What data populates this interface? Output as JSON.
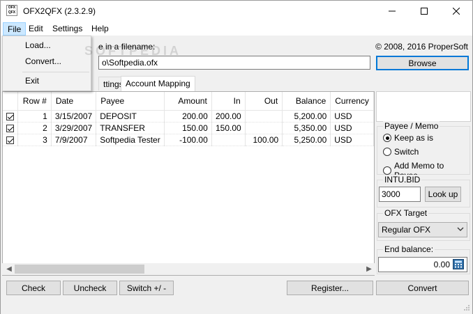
{
  "window": {
    "title": "OFX2QFX (2.3.2.9)",
    "icon_text": "OFX QFX"
  },
  "menu": [
    "File",
    "Edit",
    "Settings",
    "Help"
  ],
  "file_menu": [
    "Load...",
    "Convert...",
    "Exit"
  ],
  "top": {
    "file_label_visible": "e in a filename:",
    "file_value_visible": "o\\Softpedia.ofx",
    "copyright": "© 2008, 2016 ProperSoft",
    "browse": "Browse"
  },
  "tabs": [
    "ttings",
    "Account Mapping"
  ],
  "grid": {
    "columns": [
      "Row #",
      "Date",
      "Payee",
      "Amount",
      "In",
      "Out",
      "Balance",
      "Currency"
    ],
    "rows": [
      {
        "checked": true,
        "row": "1",
        "date": "3/15/2007",
        "payee": "DEPOSIT",
        "amount": "200.00",
        "in": "200.00",
        "out": "",
        "balance": "5,200.00",
        "currency": "USD"
      },
      {
        "checked": true,
        "row": "2",
        "date": "3/29/2007",
        "payee": "TRANSFER",
        "amount": "150.00",
        "in": "150.00",
        "out": "",
        "balance": "5,350.00",
        "currency": "USD"
      },
      {
        "checked": true,
        "row": "3",
        "date": "7/9/2007",
        "payee": "Softpedia Tester",
        "amount": "-100.00",
        "in": "",
        "out": "100.00",
        "balance": "5,250.00",
        "currency": "USD"
      }
    ]
  },
  "side": {
    "payee_title": "Payee / Memo",
    "radios": [
      "Keep as is",
      "Switch",
      "Add Memo to Payee"
    ],
    "selected_radio": "Keep as is",
    "intu_title": "INTU.BID",
    "intu_value": "3000",
    "lookup": "Look up",
    "ofx_target_title": "OFX Target",
    "ofx_target_value": "Regular OFX",
    "end_balance_title": "End balance:",
    "end_balance_value": "0.00"
  },
  "buttons": {
    "check": "Check",
    "uncheck": "Uncheck",
    "switch": "Switch +/ -",
    "register": "Register...",
    "convert": "Convert"
  },
  "watermark": "SOFTPEDIA",
  "colors": {
    "accent": "#0078d7",
    "menu_highlight": "#cce8ff"
  }
}
